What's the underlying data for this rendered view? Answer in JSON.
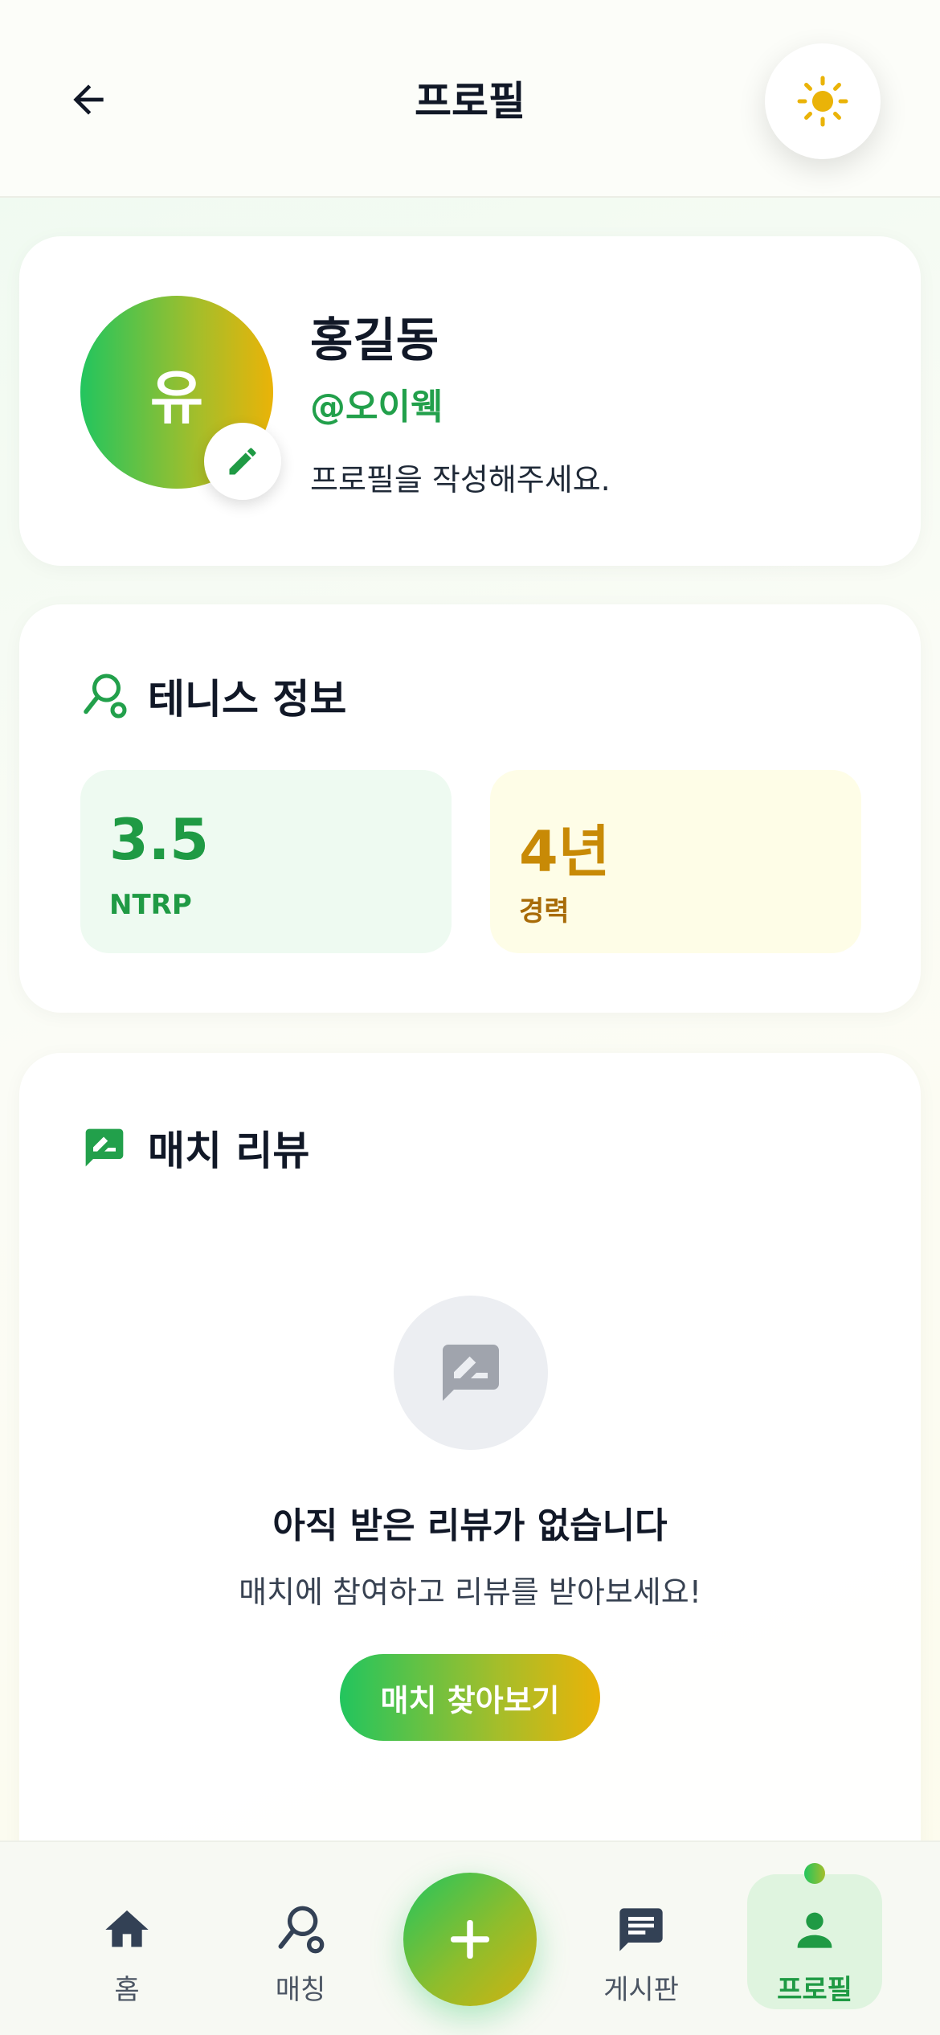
{
  "header": {
    "title": "프로필",
    "back_icon": "arrow-left-icon",
    "theme_icon": "sun-icon"
  },
  "profile": {
    "avatar_initial": "유",
    "name": "홍길동",
    "handle": "@오이웩",
    "bio": "프로필을 작성해주세요.",
    "edit_icon": "pencil-icon"
  },
  "tennis_info": {
    "title": "테니스 정보",
    "icon": "racket-icon",
    "ntrp": {
      "value": "3.5",
      "label": "NTRP"
    },
    "career": {
      "value": "4년",
      "label": "경력"
    }
  },
  "reviews": {
    "title": "매치 리뷰",
    "icon": "review-icon",
    "empty_title": "아직 받은 리뷰가 없습니다",
    "empty_subtitle": "매치에 참여하고 리뷰를 받아보세요!",
    "cta_label": "매치 찾아보기"
  },
  "bottom_nav": {
    "items": [
      {
        "label": "홈",
        "icon": "home-icon"
      },
      {
        "label": "매칭",
        "icon": "racket-icon"
      },
      {
        "label": "게시판",
        "icon": "chat-icon"
      },
      {
        "label": "프로필",
        "icon": "person-icon",
        "active": true
      }
    ],
    "fab_icon": "plus-icon"
  },
  "colors": {
    "brand_green": "#22c55e",
    "brand_gold": "#eab308",
    "accent_text_green": "#1f9a44",
    "accent_text_gold": "#c88a06"
  }
}
